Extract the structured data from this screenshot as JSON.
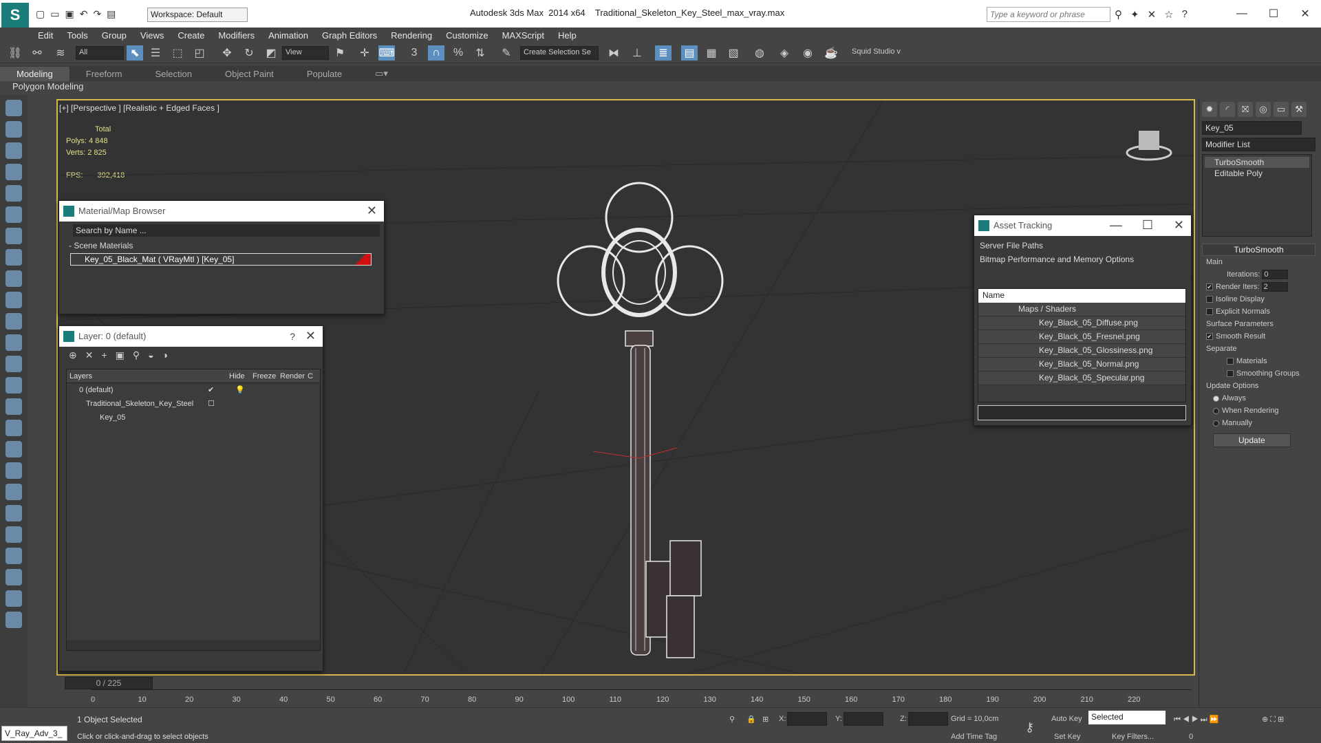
{
  "app": {
    "title_prefix": "Autodesk 3ds Max  2014 x64",
    "file_name": "Traditional_Skeleton_Key_Steel_max_vray.max",
    "workspace": "Workspace: Default",
    "search_placeholder": "Type a keyword or phrase"
  },
  "menu": [
    "Edit",
    "Tools",
    "Group",
    "Views",
    "Create",
    "Modifiers",
    "Animation",
    "Graph Editors",
    "Rendering",
    "Customize",
    "MAXScript",
    "Help"
  ],
  "toolbar": {
    "filter": "All",
    "ref_coord": "View",
    "selection_set": "Create Selection Se",
    "squid": "Squid Studio v"
  },
  "ribbon": {
    "tabs": [
      "Modeling",
      "Freeform",
      "Selection",
      "Object Paint",
      "Populate"
    ],
    "active": "Modeling",
    "sub": "Polygon Modeling"
  },
  "viewport": {
    "label": "[+] [Perspective ] [Realistic + Edged Faces ]",
    "stats_total": "Total",
    "polys_label": "Polys:",
    "polys": "4 848",
    "verts_label": "Verts:",
    "verts": "2 825",
    "fps_label": "FPS:",
    "fps": "392,418"
  },
  "material_browser": {
    "title": "Material/Map Browser",
    "search": "Search by Name ...",
    "section": "Scene Materials",
    "item": "Key_05_Black_Mat  ( VRayMtl )  [Key_05]"
  },
  "layer_window": {
    "title": "Layer: 0 (default)",
    "help": "?",
    "columns": [
      "Layers",
      "Hide",
      "Freeze",
      "Render",
      "C"
    ],
    "rows": [
      {
        "name": "0 (default)"
      },
      {
        "name": "Traditional_Skeleton_Key_Steel"
      },
      {
        "name": "Key_05"
      }
    ]
  },
  "asset_tracking": {
    "title": "Asset Tracking",
    "menu1": [
      "Server",
      "File",
      "Paths"
    ],
    "menu2": [
      "Bitmap Performance and Memory",
      "Options"
    ],
    "col_name": "Name",
    "group": "Maps / Shaders",
    "files": [
      "Key_Black_05_Diffuse.png",
      "Key_Black_05_Fresnel.png",
      "Key_Black_05_Glossiness.png",
      "Key_Black_05_Normal.png",
      "Key_Black_05_Specular.png"
    ]
  },
  "command_panel": {
    "object_name": "Key_05",
    "modifier_list": "Modifier List",
    "stack": [
      "TurboSmooth",
      "Editable Poly"
    ],
    "rollout": "TurboSmooth",
    "main": "Main",
    "iterations_label": "Iterations:",
    "iterations": "0",
    "render_iters_label": "Render Iters:",
    "render_iters": "2",
    "isoline": "Isoline Display",
    "explicit": "Explicit Normals",
    "surface": "Surface Parameters",
    "smooth": "Smooth Result",
    "separate": "Separate",
    "materials": "Materials",
    "smoothing": "Smoothing Groups",
    "update_opts": "Update Options",
    "always": "Always",
    "when_render": "When Rendering",
    "manually": "Manually",
    "update_btn": "Update"
  },
  "timeline": {
    "frame": "0 / 225",
    "ticks": [
      "0",
      "10",
      "20",
      "30",
      "40",
      "50",
      "60",
      "70",
      "80",
      "90",
      "100",
      "110",
      "120",
      "130",
      "140",
      "150",
      "160",
      "170",
      "180",
      "190",
      "200",
      "210",
      "220"
    ]
  },
  "status": {
    "selected": "1 Object Selected",
    "prompt": "Click or click-and-drag to select objects",
    "maxscript": "V_Ray_Adv_3_",
    "x": "X:",
    "y": "Y:",
    "z": "Z:",
    "grid": "Grid = 10,0cm",
    "add_time_tag": "Add Time Tag",
    "auto_key": "Auto Key",
    "set_key": "Set Key",
    "selected_dd": "Selected",
    "key_filters": "Key Filters...",
    "frame_field": "0"
  }
}
